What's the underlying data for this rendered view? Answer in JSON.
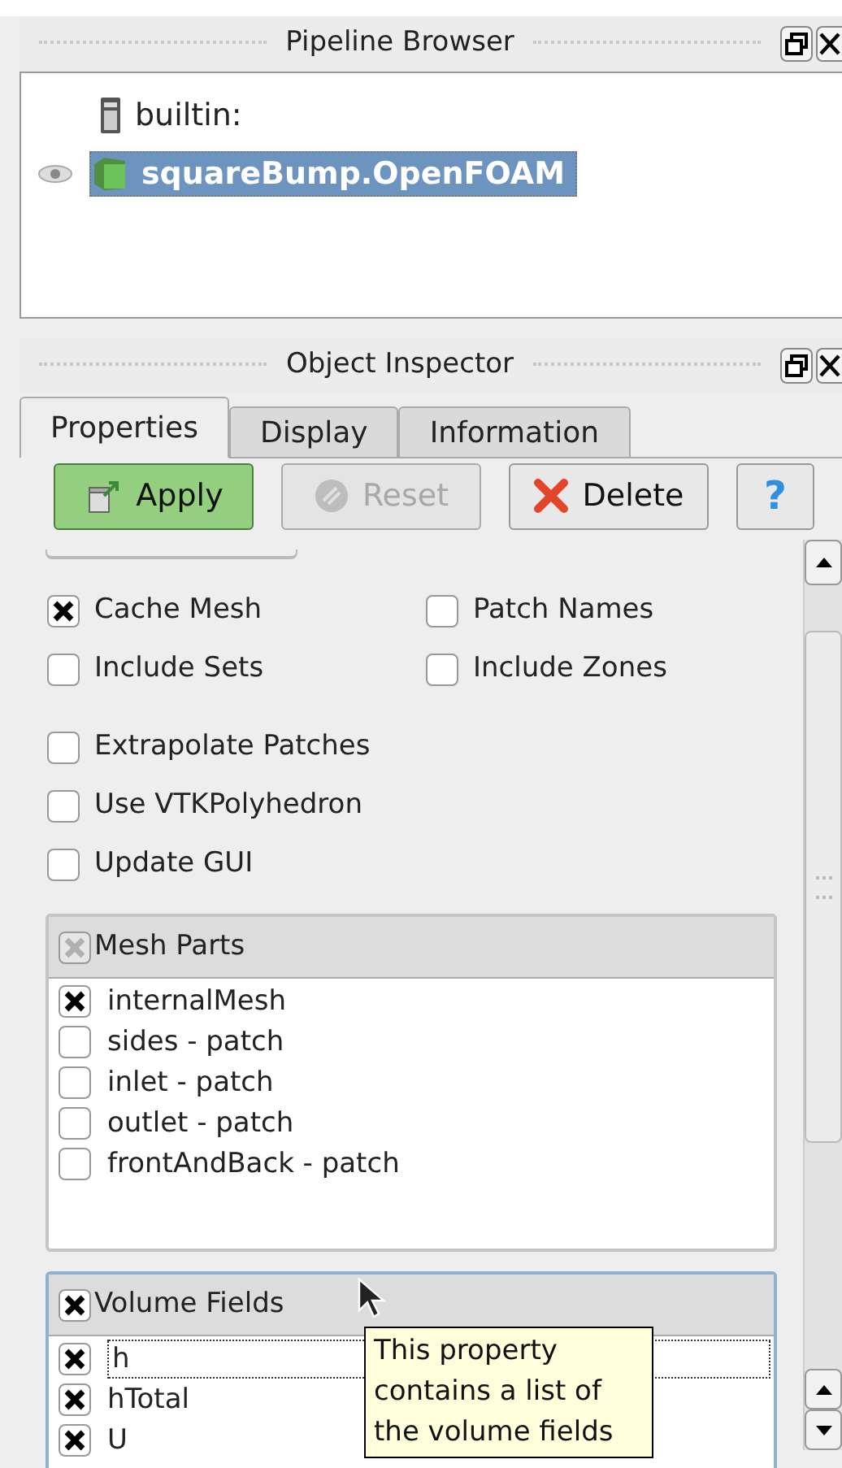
{
  "pipeline_browser": {
    "title": "Pipeline Browser",
    "items": [
      {
        "label": "builtin:",
        "kind": "server",
        "selected": false
      },
      {
        "label": "squareBump.OpenFOAM",
        "kind": "source",
        "selected": true,
        "visible": true
      }
    ]
  },
  "object_inspector": {
    "title": "Object Inspector",
    "tabs": [
      {
        "label": "Properties",
        "selected": true
      },
      {
        "label": "Display",
        "selected": false
      },
      {
        "label": "Information",
        "selected": false
      }
    ],
    "buttons": [
      {
        "label": "Apply",
        "kind": "apply",
        "disabled": false
      },
      {
        "label": "Reset",
        "kind": "reset",
        "disabled": true
      },
      {
        "label": "Delete",
        "kind": "delete",
        "disabled": false
      },
      {
        "label": "?",
        "kind": "help",
        "disabled": false
      }
    ],
    "option_groups": [
      {
        "kind": "grid",
        "options": [
          {
            "label": "Cache Mesh",
            "checked": true
          },
          {
            "label": "Patch Names",
            "checked": false
          },
          {
            "label": "Include Sets",
            "checked": false
          },
          {
            "label": "Include Zones",
            "checked": false
          }
        ]
      },
      {
        "kind": "list",
        "options": [
          {
            "label": "Extrapolate Patches",
            "checked": false
          },
          {
            "label": "Use VTKPolyhedron",
            "checked": false
          },
          {
            "label": "Update GUI",
            "checked": false
          }
        ]
      }
    ],
    "lists": [
      {
        "title": "Mesh Parts",
        "header_checked": true,
        "header_greyed": true,
        "focused": false,
        "items": [
          {
            "label": "internalMesh",
            "checked": true,
            "focused": false
          },
          {
            "label": "sides - patch",
            "checked": false,
            "focused": false
          },
          {
            "label": "inlet - patch",
            "checked": false,
            "focused": false
          },
          {
            "label": "outlet - patch",
            "checked": false,
            "focused": false
          },
          {
            "label": "frontAndBack - patch",
            "checked": false,
            "focused": false
          }
        ]
      },
      {
        "title": "Volume Fields",
        "header_checked": true,
        "header_greyed": false,
        "focused": true,
        "items": [
          {
            "label": "h",
            "checked": true,
            "focused": true
          },
          {
            "label": "hTotal",
            "checked": true,
            "focused": false
          },
          {
            "label": "U",
            "checked": true,
            "focused": false
          }
        ]
      }
    ],
    "tooltip": {
      "text": "This property contains a list of the volume fields"
    }
  }
}
